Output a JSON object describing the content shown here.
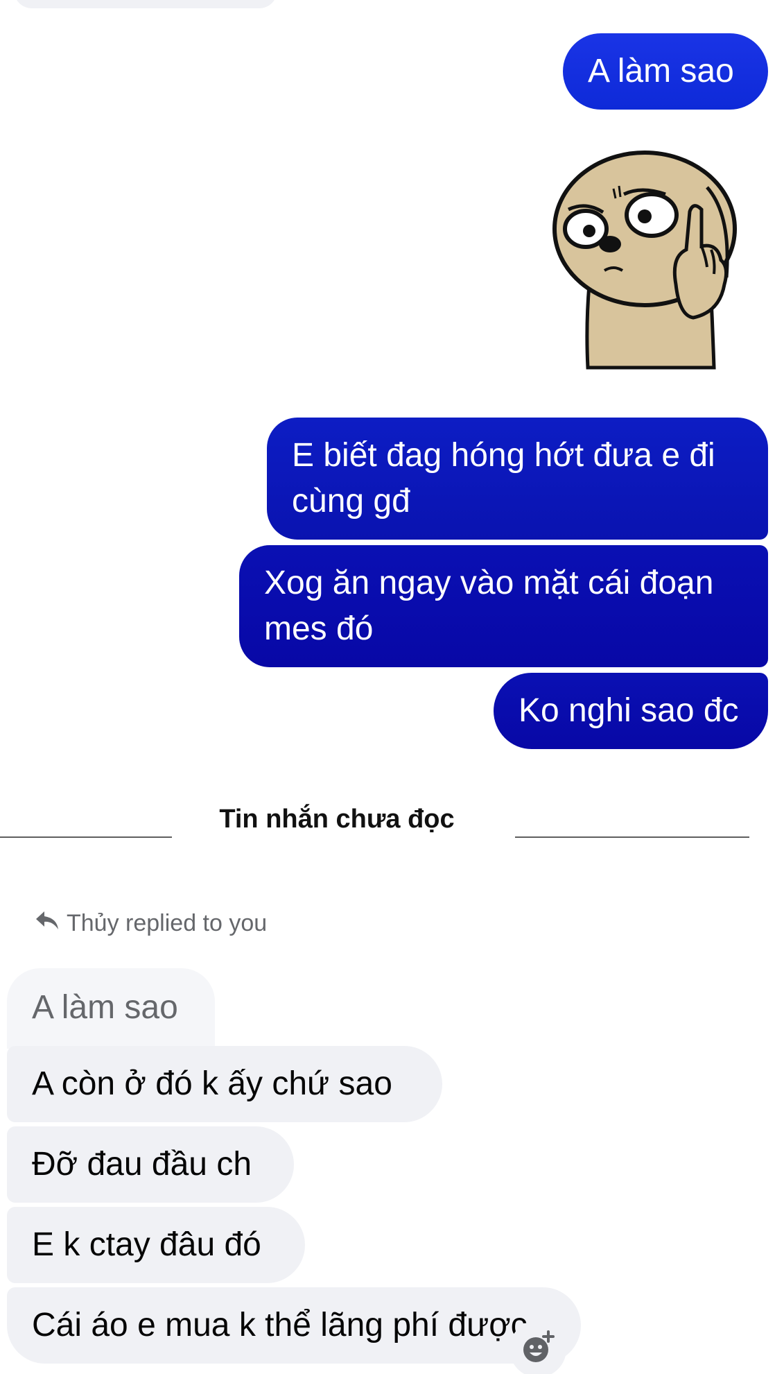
{
  "messages_sent": [
    {
      "text": "A làm sao"
    },
    {
      "text": "E biết đag hóng hớt đưa e đi\ncùng gđ"
    },
    {
      "text": "Xog ăn ngay vào mặt cái đoạn\nmes đó"
    },
    {
      "text": "Ko nghi sao đc"
    }
  ],
  "sticker": {
    "icon": "sloth-sticker-icon"
  },
  "divider": {
    "label": "Tin nhắn chưa đọc"
  },
  "reply": {
    "caption": "Thủy replied to you",
    "quoted_text": "A làm sao"
  },
  "messages_received": [
    {
      "text": "A còn ở đó k ấy chứ sao"
    },
    {
      "text": "Đỡ đau đầu ch"
    },
    {
      "text": "E k ctay đâu đó"
    },
    {
      "text": "Cái áo e mua k thể lãng phí được"
    }
  ],
  "colors": {
    "sent_bubble": "#0e2ad8",
    "received_bubble": "#f0f1f5",
    "muted_text": "#65676b"
  }
}
